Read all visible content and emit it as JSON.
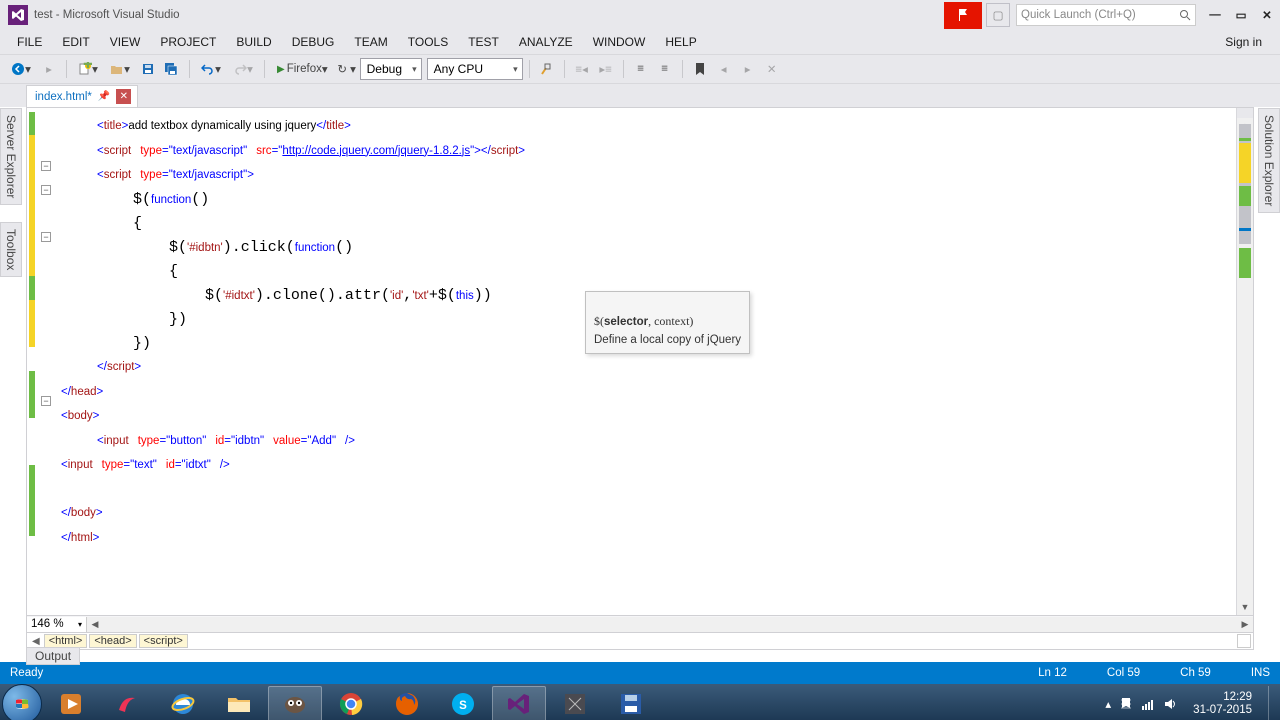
{
  "window": {
    "title": "test - Microsoft Visual Studio",
    "quick_launch_placeholder": "Quick Launch (Ctrl+Q)",
    "sign_in": "Sign in"
  },
  "menu": [
    "FILE",
    "EDIT",
    "VIEW",
    "PROJECT",
    "BUILD",
    "DEBUG",
    "TEAM",
    "TOOLS",
    "TEST",
    "ANALYZE",
    "WINDOW",
    "HELP"
  ],
  "toolbar": {
    "browser": "Firefox",
    "config": "Debug",
    "platform": "Any CPU"
  },
  "tab": {
    "filename": "index.html*"
  },
  "sidepanels": {
    "server_explorer": "Server Explorer",
    "toolbox": "Toolbox",
    "solution_explorer": "Solution Explorer"
  },
  "zoom": "146 %",
  "breadcrumbs": [
    "<html>",
    "<head>",
    "<script>"
  ],
  "output_label": "Output",
  "intellisense": {
    "sig": "$(selector, context)",
    "sig_bold": "selector",
    "desc": "Define a local copy of jQuery"
  },
  "status": {
    "ready": "Ready",
    "ln": "Ln 12",
    "col": "Col 59",
    "ch": "Ch 59",
    "ins": "INS"
  },
  "taskbar": {
    "time": "12:29",
    "date": "31-07-2015"
  },
  "code": {
    "title_text": "add textbox dynamically using jquery",
    "script_src": "http://code.jquery.com/jquery-1.8.2.js",
    "js_type": "text/javascript",
    "idbtn_sel": "'#idbtn'",
    "idtxt_sel": "'#idtxt'",
    "attr_id": "'id'",
    "attr_txt": "'txt'",
    "btn_type": "button",
    "btn_id": "idbtn",
    "btn_val": "Add",
    "txt_type": "text",
    "txt_id": "idtxt"
  }
}
